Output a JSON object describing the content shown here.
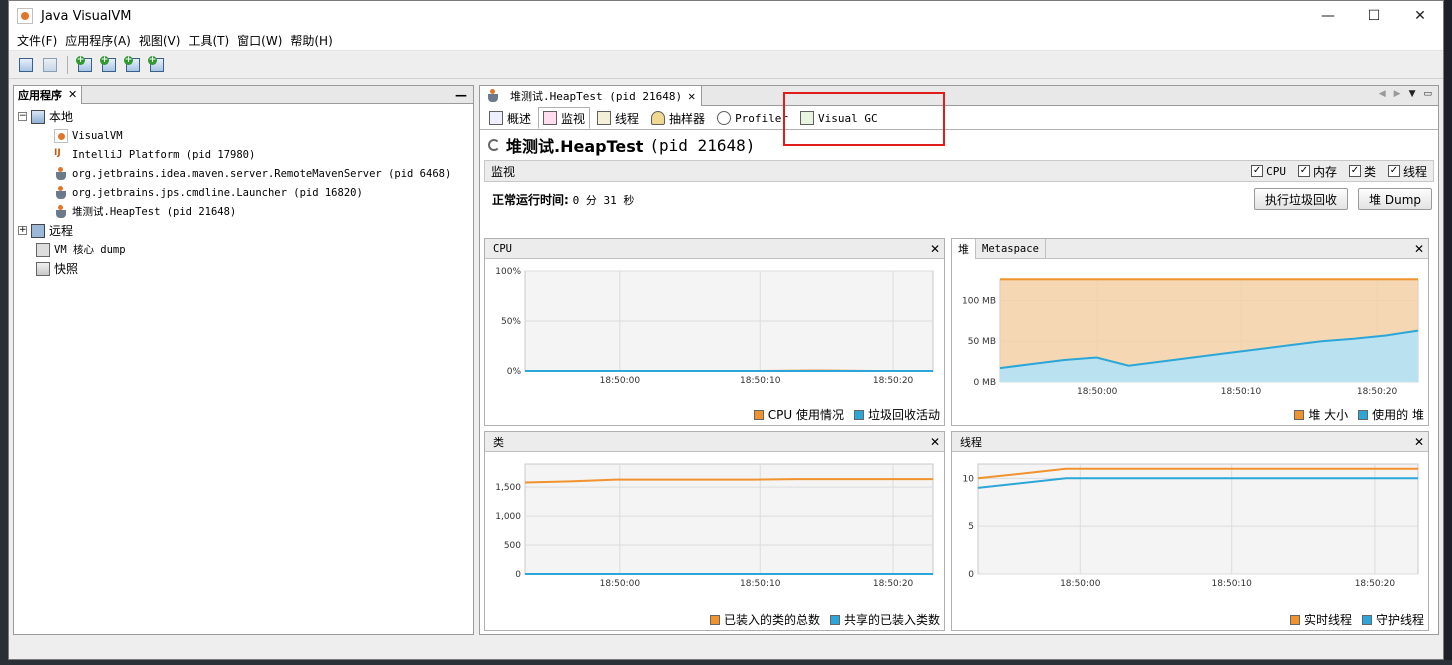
{
  "window": {
    "title": "Java VisualVM",
    "min": "—",
    "max": "☐",
    "close": "✕"
  },
  "menu": [
    "文件(F)",
    "应用程序(A)",
    "视图(V)",
    "工具(T)",
    "窗口(W)",
    "帮助(H)"
  ],
  "left_panel": {
    "tab_label": "应用程序",
    "tab_close": "✕",
    "minimize": "—",
    "tree": [
      {
        "label": "本地",
        "expander": "−"
      },
      {
        "label": "VisualVM"
      },
      {
        "label": "IntelliJ Platform (pid 17980)"
      },
      {
        "label": "org.jetbrains.idea.maven.server.RemoteMavenServer (pid 6468)"
      },
      {
        "label": "org.jetbrains.jps.cmdline.Launcher (pid 16820)"
      },
      {
        "label": "堆测试.HeapTest (pid 21648)"
      },
      {
        "label": "远程",
        "expander": "+"
      },
      {
        "label": "VM 核心 dump"
      },
      {
        "label": "快照"
      }
    ]
  },
  "doc_tab": {
    "label": "堆测试.HeapTest (pid 21648)",
    "close": "✕"
  },
  "sub_tabs": [
    "概述",
    "监视",
    "线程",
    "抽样器",
    "Profiler",
    "Visual GC"
  ],
  "process_title": {
    "name": "堆测试.HeapTest",
    "pid": "(pid 21648)"
  },
  "monitor": {
    "label": "监视",
    "checks": [
      "CPU",
      "内存",
      "类",
      "线程"
    ],
    "uptime_label": "正常运行时间:",
    "uptime_value": "0 分 31 秒",
    "gc_button": "执行垃圾回收",
    "dump_button": "堆 Dump"
  },
  "charts": {
    "cpu": {
      "title": "CPU",
      "legend": [
        "CPU 使用情况",
        "垃圾回收活动"
      ]
    },
    "heap": {
      "tabs": [
        "堆",
        "Metaspace"
      ],
      "legend": [
        "堆 大小",
        "使用的 堆"
      ]
    },
    "classes": {
      "title": "类",
      "legend": [
        "已装入的类的总数",
        "共享的已装入类数"
      ]
    },
    "threads": {
      "title": "线程",
      "legend": [
        "实时线程",
        "守护线程"
      ]
    }
  },
  "colors": {
    "orange": "#f0922d",
    "blue": "#2ca6d8",
    "highlight": "#e21b1b"
  },
  "chart_data": [
    {
      "type": "line",
      "title": "CPU",
      "x": [
        "18:50:00",
        "18:50:10",
        "18:50:20"
      ],
      "yticks": [
        "0%",
        "50%",
        "100%"
      ],
      "ylim": [
        0,
        100
      ],
      "series": [
        {
          "name": "CPU 使用情况",
          "values": [
            0,
            0,
            0,
            0,
            0,
            0.5,
            0,
            0
          ]
        },
        {
          "name": "垃圾回收活动",
          "values": [
            0,
            0,
            0,
            0,
            0,
            0,
            0,
            0
          ]
        }
      ]
    },
    {
      "type": "area",
      "title": "堆",
      "x": [
        "18:50:00",
        "18:50:10",
        "18:50:20"
      ],
      "yticks": [
        "0 MB",
        "50 MB",
        "100 MB"
      ],
      "ylim": [
        0,
        125
      ],
      "series": [
        {
          "name": "堆 大小",
          "values": [
            126,
            126,
            126,
            126,
            126,
            126,
            126,
            126,
            126,
            126,
            126,
            126,
            126,
            126
          ]
        },
        {
          "name": "使用的 堆",
          "values": [
            17,
            22,
            27,
            30,
            20,
            25,
            30,
            35,
            40,
            45,
            50,
            53,
            57,
            63
          ]
        }
      ]
    },
    {
      "type": "line",
      "title": "类",
      "x": [
        "18:50:00",
        "18:50:10",
        "18:50:20"
      ],
      "yticks": [
        "0",
        "500",
        "1,000",
        "1,500"
      ],
      "ylim": [
        0,
        1900
      ],
      "series": [
        {
          "name": "已装入的类的总数",
          "values": [
            1580,
            1600,
            1630,
            1630,
            1630,
            1630,
            1640,
            1640,
            1640,
            1640
          ]
        },
        {
          "name": "共享的已装入类数",
          "values": [
            0,
            0,
            0,
            0,
            0,
            0,
            0,
            0,
            0,
            0
          ]
        }
      ]
    },
    {
      "type": "line",
      "title": "线程",
      "x": [
        "18:50:00",
        "18:50:10",
        "18:50:20"
      ],
      "yticks": [
        "0",
        "5",
        "10"
      ],
      "ylim": [
        0,
        11.5
      ],
      "series": [
        {
          "name": "实时线程",
          "values": [
            10,
            11,
            11,
            11,
            11,
            11
          ]
        },
        {
          "name": "守护线程",
          "values": [
            9,
            10,
            10,
            10,
            10,
            10
          ]
        }
      ]
    }
  ]
}
